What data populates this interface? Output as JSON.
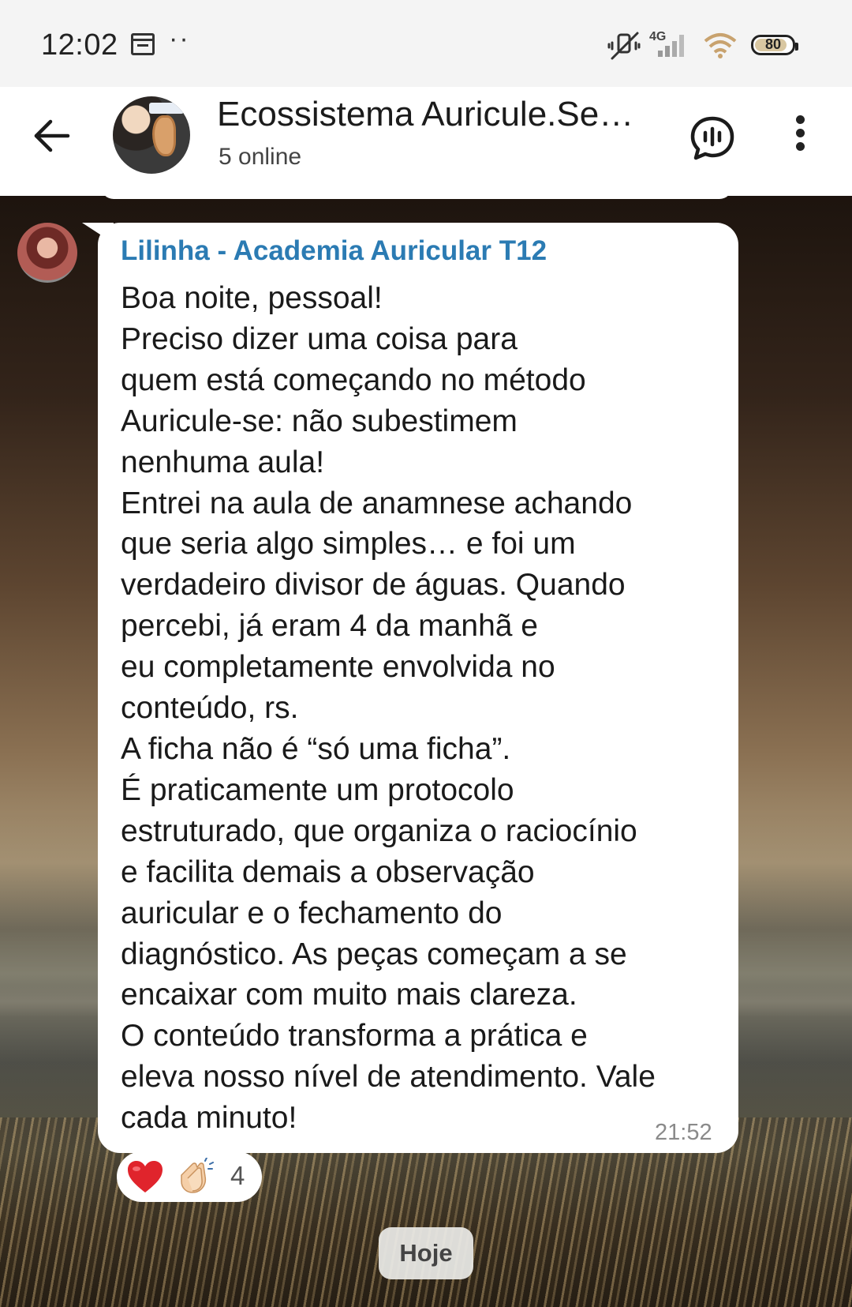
{
  "status_bar": {
    "time": "12:02",
    "network": "4G",
    "battery": "80",
    "icons": [
      "calendar-icon",
      "more-dots-icon",
      "mute-icon",
      "signal-icon",
      "wifi-icon",
      "battery-icon"
    ]
  },
  "header": {
    "title": "Ecossistema Auricule.Se…",
    "subtitle": "5 online",
    "icons": [
      "back-arrow-icon",
      "group-avatar",
      "voice-chat-icon",
      "more-vertical-icon"
    ]
  },
  "message": {
    "sender": "Lilinha - Academia Auricular T12",
    "sender_color": "#2b7bb3",
    "lines": [
      "Boa noite, pessoal!",
      "Preciso dizer uma coisa para",
      "quem está começando no método",
      "Auricule-se: não subestimem",
      "nenhuma aula!",
      "Entrei na aula de anamnese achando",
      "que seria algo simples… e foi um",
      "verdadeiro divisor de águas. Quando",
      "percebi, já eram 4 da manhã e",
      "eu completamente envolvida no",
      "conteúdo, rs.",
      "A ficha não é “só uma ficha”.",
      "É praticamente um protocolo",
      "estruturado, que organiza o raciocínio",
      "e facilita demais a observação",
      "auricular e o fechamento do",
      "diagnóstico. As peças começam a se",
      "encaixar com muito mais clareza.",
      "O conteúdo transforma a prática e",
      "eleva nosso nível de atendimento. Vale",
      "cada minuto!"
    ],
    "time": "21:52",
    "reactions": {
      "emojis": [
        "heart-icon",
        "clapping-hands-icon"
      ],
      "count": "4"
    }
  },
  "date_separator": "Hoje"
}
